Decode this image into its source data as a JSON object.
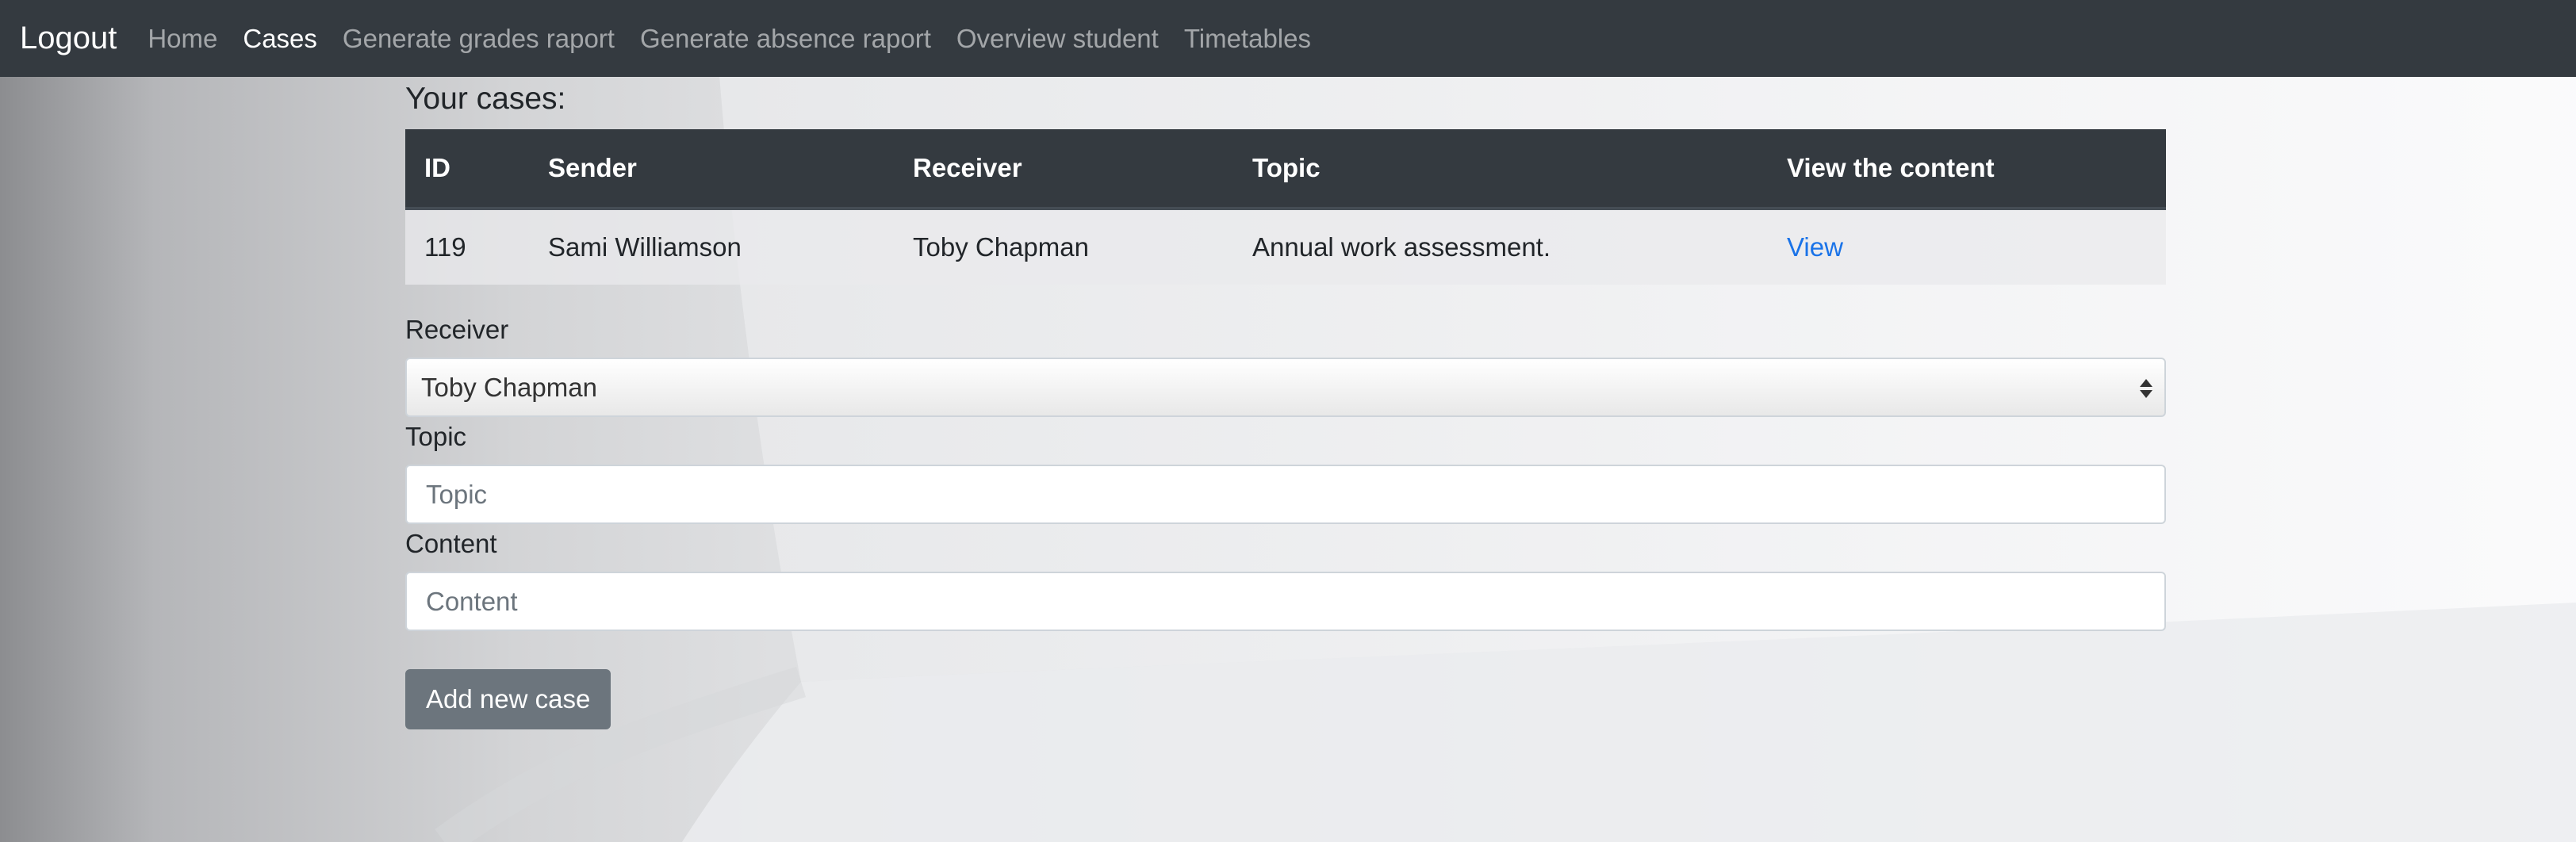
{
  "navbar": {
    "brand": "Logout",
    "links": [
      {
        "label": "Home"
      },
      {
        "label": "Cases"
      },
      {
        "label": "Generate grades raport"
      },
      {
        "label": "Generate absence raport"
      },
      {
        "label": "Overview student"
      },
      {
        "label": "Timetables"
      }
    ]
  },
  "page": {
    "heading": "Your cases:"
  },
  "table": {
    "columns": [
      "ID",
      "Sender",
      "Receiver",
      "Topic",
      "View the content"
    ],
    "rows": [
      {
        "id": "119",
        "sender": "Sami Williamson",
        "receiver": "Toby Chapman",
        "topic": "Annual work assessment.",
        "view": "View"
      }
    ]
  },
  "form": {
    "receiver_label": "Receiver",
    "receiver_value": "Toby Chapman",
    "topic_label": "Topic",
    "topic_placeholder": "Topic",
    "content_label": "Content",
    "content_placeholder": "Content",
    "submit_label": "Add new case"
  },
  "colors": {
    "navbar": "#343a40",
    "link": "#1a73e8",
    "button": "#6c757d"
  }
}
